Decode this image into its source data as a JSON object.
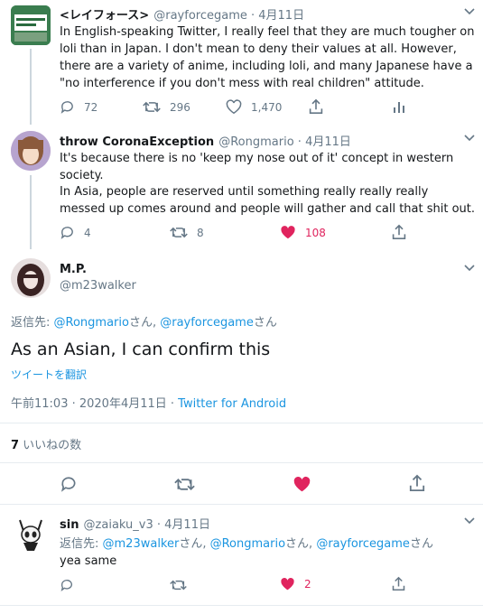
{
  "tweets": [
    {
      "name": "<レイフォース>",
      "handle": "@rayforcegame",
      "date": "4月11日",
      "text": "In English-speaking Twitter, I really feel that they are much tougher on loli than in Japan. I don't mean to deny their values at all. However, there are a variety of anime, including loli, and many Japanese have a \"no interference if you don't mess with real children\" attitude.",
      "replies": "72",
      "retweets": "296",
      "likes": "1,470"
    },
    {
      "name": "throw CoronaException",
      "handle": "@Rongmario",
      "date": "4月11日",
      "text1": "It's because there is no 'keep my nose out of it' concept in western society.",
      "text2": "In Asia, people are reserved until something really really really messed up comes around and people will gather and call that shit out.",
      "replies": "4",
      "retweets": "8",
      "likes": "108"
    }
  ],
  "focus": {
    "name": "M.P.",
    "handle": "@m23walker",
    "reply_prefix": "返信先: ",
    "mention1": "@Rongmario",
    "san1": "さん, ",
    "mention2": "@rayforcegame",
    "san2": "さん",
    "text": "As an Asian, I can confirm this",
    "translate": "ツイートを翻訳",
    "timestamp": "午前11:03 · 2020年4月11日 · ",
    "source": "Twitter for Android",
    "like_count": "7",
    "like_label": " いいねの数"
  },
  "reply": {
    "name": "sin",
    "handle": "@zaiaku_v3",
    "date": "4月11日",
    "reply_prefix": "返信先: ",
    "mention1": "@m23walker",
    "san1": "さん, ",
    "mention2": "@Rongmario",
    "san2": "さん, ",
    "mention3": "@rayforcegame",
    "san3": "さん",
    "text": "yea same",
    "likes": "2"
  },
  "sep": " · ",
  "colors": {
    "link": "#1b95e0",
    "like": "#e0245e",
    "muted": "#657786",
    "line": "#ccd6dd"
  },
  "icons": [
    "reply-icon",
    "retweet-icon",
    "like-icon",
    "share-icon",
    "analytics-icon",
    "chevron-down-icon"
  ]
}
